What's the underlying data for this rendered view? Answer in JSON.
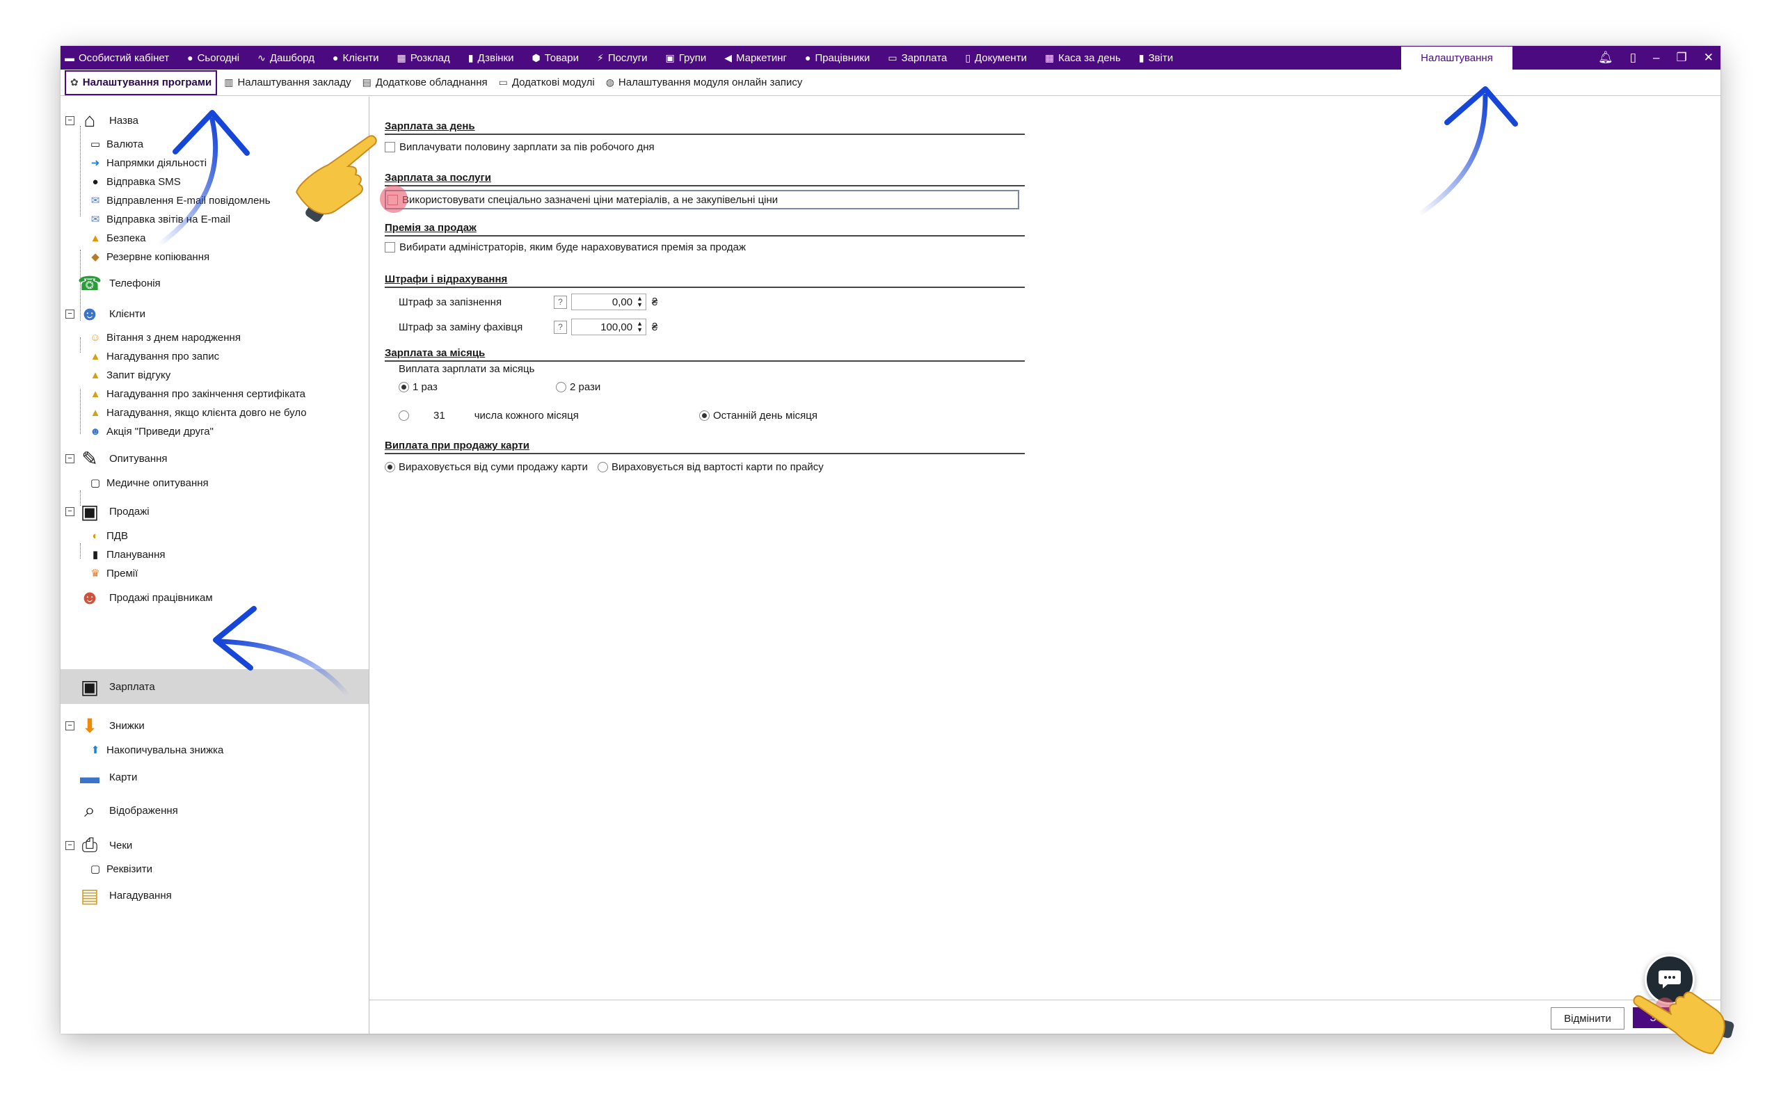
{
  "topnav": {
    "items": [
      {
        "icon": "briefcase-icon",
        "glyph": "▬",
        "label": "Особистий кабінет"
      },
      {
        "icon": "calendar-today-icon",
        "glyph": "●",
        "label": "Сьогодні"
      },
      {
        "icon": "pulse-icon",
        "glyph": "∿",
        "label": "Дашборд"
      },
      {
        "icon": "user-icon",
        "glyph": "●",
        "label": "Клієнти"
      },
      {
        "icon": "schedule-icon",
        "glyph": "▦",
        "label": "Розклад"
      },
      {
        "icon": "phone-icon",
        "glyph": "▮",
        "label": "Дзвінки"
      },
      {
        "icon": "box-icon",
        "glyph": "⬢",
        "label": "Товари"
      },
      {
        "icon": "lightning-icon",
        "glyph": "⚡",
        "label": "Послуги"
      },
      {
        "icon": "groups-icon",
        "glyph": "▣",
        "label": "Групи"
      },
      {
        "icon": "megaphone-icon",
        "glyph": "◀",
        "label": "Маркетинг"
      },
      {
        "icon": "worker-icon",
        "glyph": "●",
        "label": "Працівники"
      },
      {
        "icon": "money-icon",
        "glyph": "▭",
        "label": "Зарплата"
      },
      {
        "icon": "document-icon",
        "glyph": "▯",
        "label": "Документи"
      },
      {
        "icon": "calculator-icon",
        "glyph": "▦",
        "label": "Каса за день"
      },
      {
        "icon": "bar-chart-icon",
        "glyph": "▮",
        "label": "Звіти"
      }
    ],
    "active": "Налаштування"
  },
  "tabs2": [
    {
      "icon": "gear-icon",
      "glyph": "✿",
      "label": "Налаштування програми",
      "active": true
    },
    {
      "icon": "building-icon",
      "glyph": "▥",
      "label": "Налаштування закладу",
      "active": false
    },
    {
      "icon": "printer-icon",
      "glyph": "▤",
      "label": "Додаткове обладнання",
      "active": false
    },
    {
      "icon": "modules-icon",
      "glyph": "▭",
      "label": "Додаткові модулі",
      "active": false
    },
    {
      "icon": "globe-icon",
      "glyph": "◍",
      "label": "Налаштування модуля онлайн запису",
      "active": false
    }
  ],
  "tree": {
    "name": "Назва",
    "currency": "Валюта",
    "directions": "Напрямки діяльності",
    "sms": "Відправка SMS",
    "email_msgs": "Відправлення E-mail повідомлень",
    "email_reports": "Відправка звітів на E-mail",
    "security": "Безпека",
    "backup": "Резервне копіювання",
    "telephony": "Телефонія",
    "clients": "Клієнти",
    "birthday": "Вітання з днем народження",
    "reminder_record": "Нагадування про запис",
    "feedback": "Запит відгуку",
    "reminder_cert": "Нагадування про закінчення сертифіката",
    "reminder_absent": "Нагадування, якщо клієнта довго не було",
    "promo_friend": "Акція \"Приведи друга\"",
    "surveys": "Опитування",
    "medical_survey": "Медичне опитування",
    "sales": "Продажі",
    "vat": "ПДВ",
    "planning": "Планування",
    "bonuses": "Премії",
    "employee_sales": "Продажі працівникам",
    "salary": "Зарплата",
    "discounts": "Знижки",
    "cumulative_discount": "Накопичувальна знижка",
    "cards": "Карти",
    "display": "Відображення",
    "receipts": "Чеки",
    "requisites": "Реквізити",
    "reminders": "Нагадування"
  },
  "content": {
    "daily_title": "Зарплата за день",
    "daily_half": "Виплачувати половину зарплати за пів робочого дня",
    "services_title": "Зарплата за послуги",
    "services_special_prices": "Використовувати спеціально зазначені ціни матеріалів, а не закупівельні ціни",
    "sales_bonus_title": "Премія за продаж",
    "sales_bonus_admins": "Вибирати адміністраторів, яким буде нараховуватися премія за продаж",
    "fines_title": "Штрафи і відрахування",
    "fine_late_label": "Штраф за запізнення",
    "fine_late_value": "0,00",
    "fine_replace_label": "Штраф за заміну фахівця",
    "fine_replace_value": "100,00",
    "currency_sign": "₴",
    "help_mark": "?",
    "monthly_title": "Зарплата за місяць",
    "monthly_payout_label": "Виплата зарплати за місяць",
    "once": "1 раз",
    "twice": "2 рази",
    "day_number": "31",
    "day_of_month": "числа кожного місяця",
    "last_day": "Останній день місяця",
    "card_sale_title": "Виплата при продажу карти",
    "card_from_sale": "Вираховується від суми продажу карти",
    "card_from_price": "Вираховується від вартості карти по прайсу"
  },
  "buttons": {
    "cancel": "Відмінити",
    "save": "Збер..."
  },
  "colors": {
    "brand": "#4b0a80",
    "arrow": "#1646d8"
  }
}
